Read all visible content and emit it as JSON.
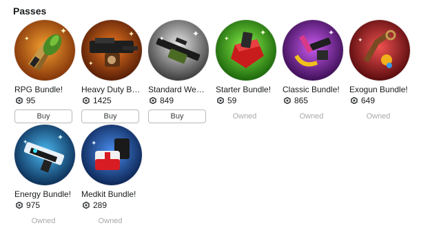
{
  "section": {
    "title": "Passes"
  },
  "passes": [
    {
      "name": "RPG Bundle!",
      "price": "95",
      "status": "Buy",
      "icon": "rpg-bundle-icon",
      "bg": "#e07a1f",
      "bg2": "#7a2c06"
    },
    {
      "name": "Heavy Duty Bun...",
      "price": "1425",
      "status": "Buy",
      "icon": "heavy-duty-bundle-icon",
      "bg": "#d85a12",
      "bg2": "#4a1604"
    },
    {
      "name": "Standard Weapo...",
      "price": "849",
      "status": "Buy",
      "icon": "standard-weapon-bundle-icon",
      "bg": "#bdbdbd",
      "bg2": "#3c3c3c"
    },
    {
      "name": "Starter Bundle!",
      "price": "59",
      "status": "Owned",
      "icon": "starter-bundle-icon",
      "bg": "#5ed23a",
      "bg2": "#125a06"
    },
    {
      "name": "Classic Bundle!",
      "price": "865",
      "status": "Owned",
      "icon": "classic-bundle-icon",
      "bg": "#a637d6",
      "bg2": "#32094a"
    },
    {
      "name": "Exogun Bundle!",
      "price": "649",
      "status": "Owned",
      "icon": "exogun-bundle-icon",
      "bg": "#d8323a",
      "bg2": "#4c0608"
    },
    {
      "name": "Energy Bundle!",
      "price": "975",
      "status": "Owned",
      "icon": "energy-bundle-icon",
      "bg": "#2a8fd8",
      "bg2": "#07234a"
    },
    {
      "name": "Medkit Bundle!",
      "price": "289",
      "status": "Owned",
      "icon": "medkit-bundle-icon",
      "bg": "#2a6fd8",
      "bg2": "#081d48"
    }
  ],
  "colors": {
    "owned_text": "#a8a8a8",
    "button_border": "#b8b8b8"
  }
}
